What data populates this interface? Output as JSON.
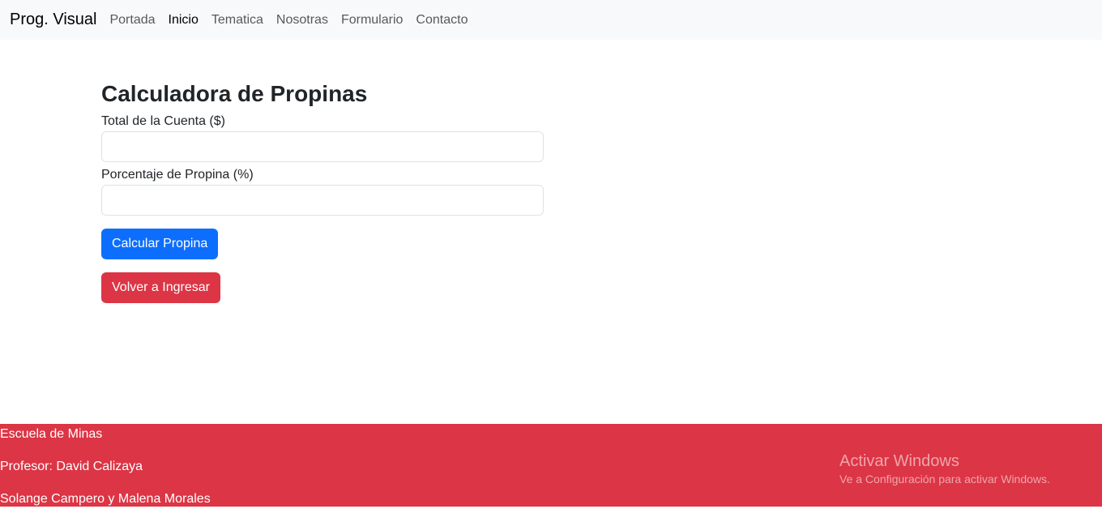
{
  "navbar": {
    "brand": "Prog. Visual",
    "links": [
      {
        "label": "Portada",
        "active": false
      },
      {
        "label": "Inicio",
        "active": true
      },
      {
        "label": "Tematica",
        "active": false
      },
      {
        "label": "Nosotras",
        "active": false
      },
      {
        "label": "Formulario",
        "active": false
      },
      {
        "label": "Contacto",
        "active": false
      }
    ]
  },
  "form": {
    "title": "Calculadora de Propinas",
    "total_label": "Total de la Cuenta ($)",
    "total_value": "",
    "percent_label": "Porcentaje de Propina (%)",
    "percent_value": "",
    "calc_button": "Calcular Propina",
    "reset_button": "Volver a Ingresar"
  },
  "footer": {
    "line1": "Escuela de Minas",
    "line2": "Profesor: David Calizaya",
    "line3": "Solange Campero y Malena Morales"
  },
  "watermark": {
    "title": "Activar Windows",
    "subtitle": "Ve a Configuración para activar Windows."
  },
  "colors": {
    "primary": "#0d6efd",
    "danger": "#dc3545",
    "navbar_bg": "#f8f9fa"
  }
}
